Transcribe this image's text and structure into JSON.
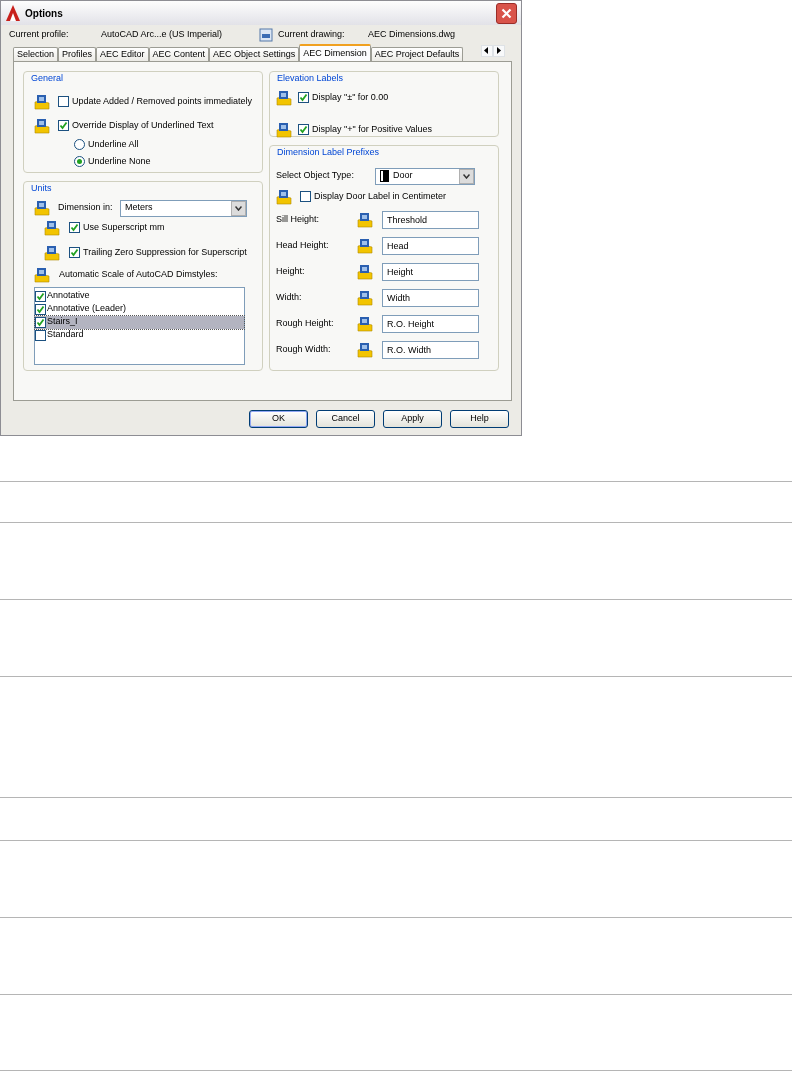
{
  "window": {
    "title": "Options"
  },
  "profile": {
    "label": "Current profile:",
    "value": "AutoCAD Arc...e (US Imperial)"
  },
  "drawing": {
    "label": "Current drawing:",
    "value": "AEC Dimensions.dwg"
  },
  "tabs": [
    {
      "label": "Selection",
      "selected": false
    },
    {
      "label": "Profiles",
      "selected": false
    },
    {
      "label": "AEC Editor",
      "selected": false
    },
    {
      "label": "AEC Content",
      "selected": false
    },
    {
      "label": "AEC Object Settings",
      "selected": false
    },
    {
      "label": "AEC Dimension",
      "selected": true
    },
    {
      "label": "AEC Project Defaults",
      "selected": false
    }
  ],
  "general": {
    "title": "General",
    "options": [
      {
        "label": "Update Added / Removed points immediately",
        "checked": false
      },
      {
        "label": "Override Display of Underlined Text",
        "checked": true
      }
    ],
    "radios": [
      {
        "label": "Underline All",
        "selected": false
      },
      {
        "label": "Underline None",
        "selected": true
      }
    ]
  },
  "units": {
    "title": "Units",
    "dimension_label": "Dimension in:",
    "dimension_value": "Meters",
    "options": [
      {
        "label": "Use Superscript mm",
        "checked": true
      },
      {
        "label": "Trailing Zero Suppression for Superscript",
        "checked": true
      }
    ],
    "list_label": "Automatic Scale of AutoCAD Dimstyles:",
    "dimstyles": [
      {
        "label": "Annotative",
        "checked": true,
        "selected": false
      },
      {
        "label": "Annotative (Leader)",
        "checked": true,
        "selected": false
      },
      {
        "label": "Stairs_I",
        "checked": true,
        "selected": true
      },
      {
        "label": "Standard",
        "checked": false,
        "selected": false
      }
    ]
  },
  "elevation": {
    "title": "Elevation Labels",
    "options": [
      {
        "label": "Display \"±\" for 0.00",
        "checked": true
      },
      {
        "label": "Display \"+\" for Positive Values",
        "checked": true
      }
    ]
  },
  "prefixes": {
    "title": "Dimension Label Prefixes",
    "object_type_label": "Select Object Type:",
    "object_type_value": "Door",
    "centimeter": {
      "label": "Display Door Label in Centimeter",
      "checked": false
    },
    "fields": [
      {
        "label": "Sill Height:",
        "value": "Threshold"
      },
      {
        "label": "Head Height:",
        "value": "Head"
      },
      {
        "label": "Height:",
        "value": "Height"
      },
      {
        "label": "Width:",
        "value": "Width"
      },
      {
        "label": "Rough Height:",
        "value": "R.O. Height"
      },
      {
        "label": "Rough Width:",
        "value": "R.O. Width"
      }
    ]
  },
  "buttons": [
    {
      "label": "OK",
      "default": true
    },
    {
      "label": "Cancel",
      "default": false
    },
    {
      "label": "Apply",
      "default": false
    },
    {
      "label": "Help",
      "default": false
    }
  ]
}
